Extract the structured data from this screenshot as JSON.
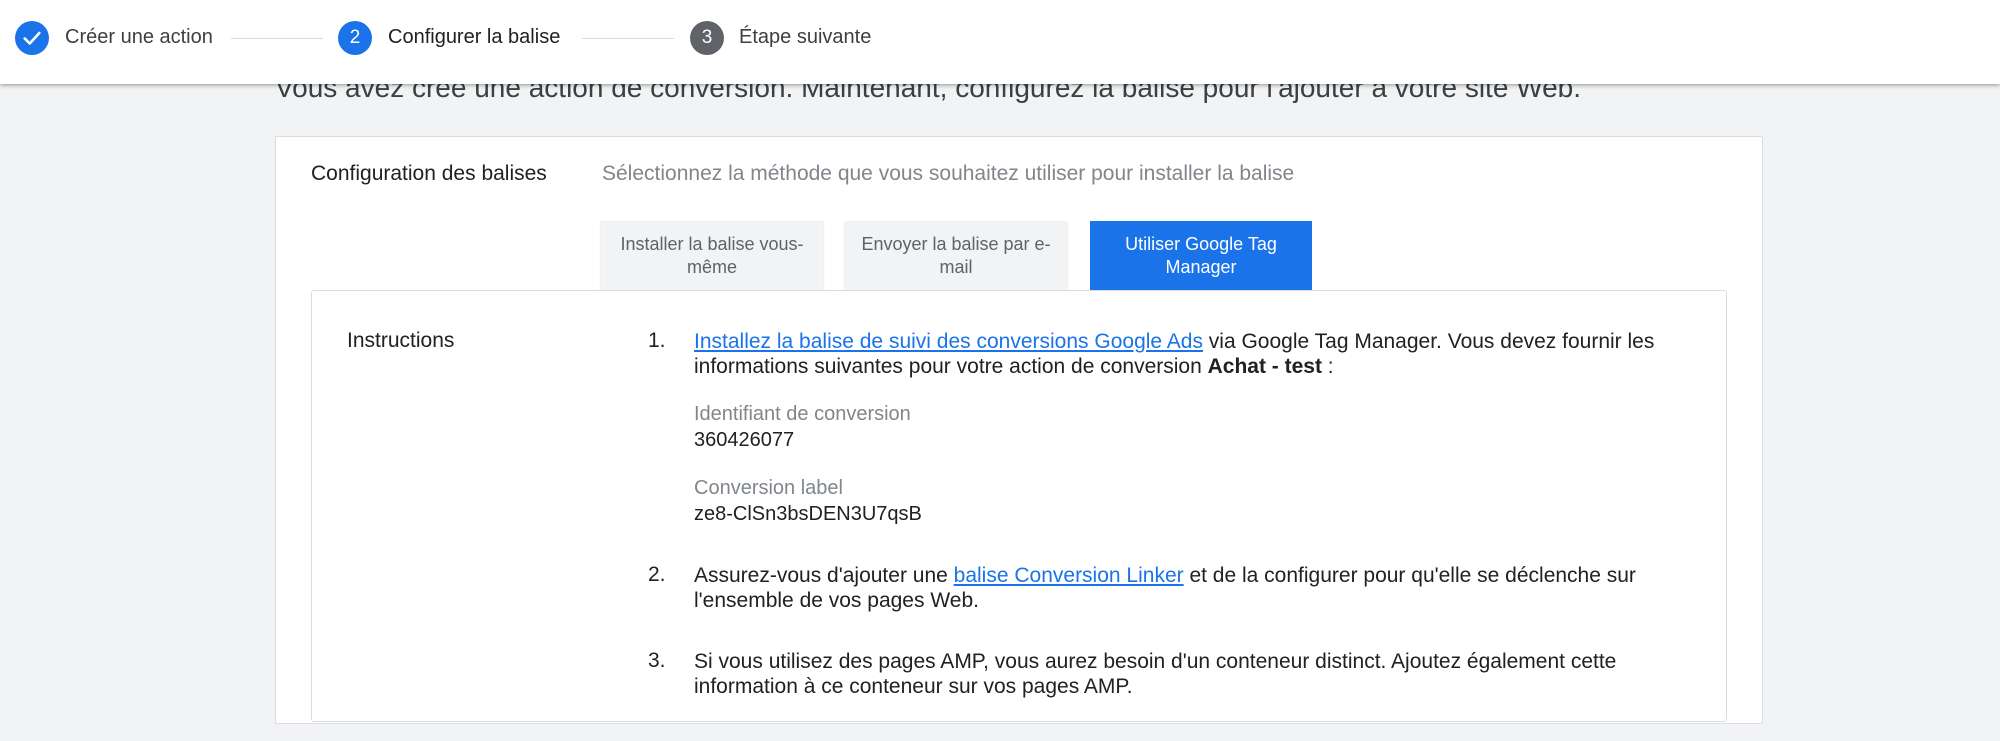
{
  "stepper": {
    "steps": [
      {
        "label": "Créer une action",
        "state": "done"
      },
      {
        "label": "Configurer la balise",
        "number": "2",
        "state": "active"
      },
      {
        "label": "Étape suivante",
        "number": "3",
        "state": "upcoming"
      }
    ]
  },
  "intro": "Vous avez créé une action de conversion. Maintenant, configurez la balise pour l'ajouter à votre site Web.",
  "config": {
    "title": "Configuration des balises",
    "description": "Sélectionnez la méthode que vous souhaitez utiliser pour installer la balise",
    "methods": [
      {
        "label": "Installer la balise vous-même",
        "selected": false
      },
      {
        "label": "Envoyer la balise par e-mail",
        "selected": false
      },
      {
        "label": "Utiliser Google Tag Manager",
        "selected": true
      }
    ]
  },
  "instructions": {
    "title": "Instructions",
    "items": [
      {
        "num": "1.",
        "link": "Installez la balise de suivi des conversions Google Ads",
        "text_after_link": " via Google Tag Manager. Vous devez fournir les informations suivantes pour votre action de conversion ",
        "bold": "Achat - test",
        "text_end": " :"
      },
      {
        "num": "2.",
        "text_before_link": "Assurez-vous d'ajouter une ",
        "link": "balise Conversion Linker",
        "text_after_link": " et de la configurer pour qu'elle se déclenche sur l'ensemble de vos pages Web."
      },
      {
        "num": "3.",
        "text": "Si vous utilisez des pages AMP, vous aurez besoin d'un conteneur distinct. Ajoutez également cette information à ce conteneur sur vos pages AMP."
      }
    ],
    "fields": [
      {
        "label": "Identifiant de conversion",
        "value": "360426077"
      },
      {
        "label": "Conversion label",
        "value": "ze8-ClSn3bsDEN3U7qsB"
      }
    ]
  },
  "colors": {
    "accent": "#1a73e8",
    "upcoming": "#5f6368",
    "background": "#f1f3f4"
  },
  "icons": {
    "step_done": "check-icon"
  }
}
